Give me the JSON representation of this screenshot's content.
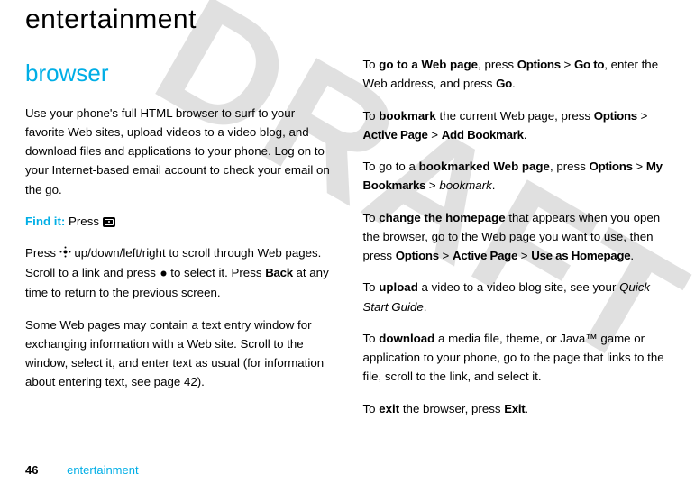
{
  "title": "entertainment",
  "watermark": "DRAFT",
  "left": {
    "section": "browser",
    "intro": "Use your phone's full HTML browser to surf to your favorite Web sites, upload videos to a video blog, and download files and applications to your phone. Log on to your Internet-based email account to check your email on the go.",
    "findit_label": "Find it:",
    "findit_text": " Press ",
    "p2a": "Press ",
    "p2b": " up/down/left/right to scroll through Web pages. Scroll to a link and press ",
    "p2c": " to select it. Press ",
    "back": "Back",
    "p2d": " at any time to return to the previous screen.",
    "p3": "Some Web pages may contain a text entry window for exchanging information with a Web site. Scroll to the window, select it, and enter text as usual (for information about entering text, see page 42)."
  },
  "right": {
    "goto": {
      "a": "To ",
      "b": "go to a Web page",
      "c": ", press ",
      "opt": "Options",
      "gt": " > ",
      "goto": "Go to",
      "d": ", enter the Web address, and press ",
      "go": "Go",
      "e": "."
    },
    "bookmark": {
      "a": "To ",
      "b": "bookmark",
      "c": " the current Web page, press ",
      "opt": "Options",
      "gt1": " > ",
      "ap": "Active Page",
      "gt2": " > ",
      "add": "Add Bookmark",
      "e": "."
    },
    "bmpage": {
      "a": "To go to a ",
      "b": "bookmarked Web page",
      "c": ", press ",
      "opt": "Options",
      "gt1": " > ",
      "my": "My Bookmarks",
      "gt2": " > ",
      "bm": "bookmark",
      "e": "."
    },
    "home": {
      "a": "To ",
      "b": "change the homepage",
      "c": " that appears when you open the browser, go to the Web page you want to use, then press ",
      "opt": "Options",
      "gt1": " > ",
      "ap": "Active Page",
      "gt2": " > ",
      "use": "Use as Homepage",
      "e": "."
    },
    "upload": {
      "a": "To ",
      "b": "upload",
      "c": " a video to a video blog site, see your ",
      "qsg": "Quick Start Guide",
      "e": "."
    },
    "download": {
      "a": "To ",
      "b": "download",
      "c": " a media file, theme, or Java™ game or application to your phone, go to the page that links to the file, scroll to the link, and select it."
    },
    "exit": {
      "a": "To ",
      "b": "exit",
      "c": " the browser, press ",
      "ex": "Exit",
      "e": "."
    }
  },
  "footer": {
    "page": "46",
    "section": "entertainment"
  }
}
